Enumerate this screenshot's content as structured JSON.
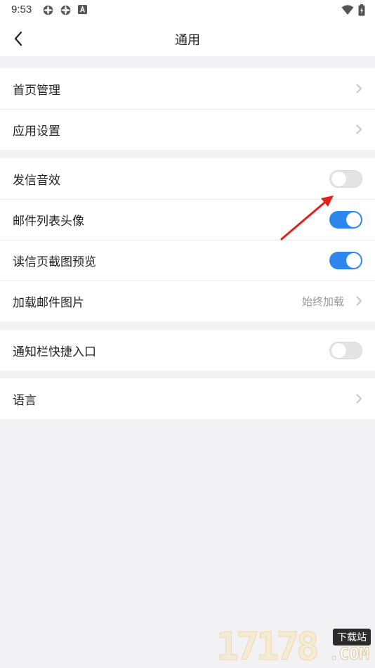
{
  "status_bar": {
    "time": "9:53",
    "left_icons": [
      "settings-gear-icon",
      "settings-gear-icon",
      "notification-a-icon"
    ],
    "right_icons": [
      "wifi-icon",
      "battery-charging-icon"
    ]
  },
  "nav": {
    "title": "通用",
    "back_icon": "chevron-left-icon"
  },
  "groups": [
    {
      "items": [
        {
          "label": "首页管理",
          "control": "chevron"
        },
        {
          "label": "应用设置",
          "control": "chevron"
        }
      ]
    },
    {
      "items": [
        {
          "label": "发信音效",
          "control": "toggle",
          "on": false
        },
        {
          "label": "邮件列表头像",
          "control": "toggle",
          "on": true
        },
        {
          "label": "读信页截图预览",
          "control": "toggle",
          "on": true
        },
        {
          "label": "加载邮件图片",
          "control": "chevron",
          "value": "始终加载"
        }
      ]
    },
    {
      "items": [
        {
          "label": "通知栏快捷入口",
          "control": "toggle",
          "on": false
        }
      ]
    },
    {
      "items": [
        {
          "label": "语言",
          "control": "chevron"
        }
      ]
    }
  ],
  "colors": {
    "accent": "#2d86ee",
    "annotation_arrow": "#e0201b",
    "background": "#f2f2f4"
  },
  "watermark": {
    "digits": "17178",
    "badge": "下载站",
    "domain": ".COM"
  }
}
